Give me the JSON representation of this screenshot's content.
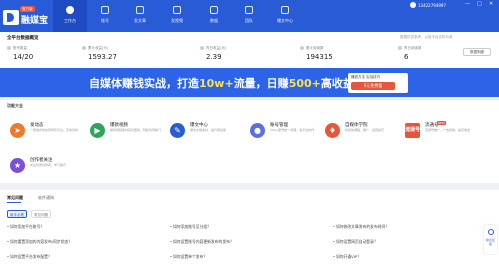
{
  "app": {
    "name": "融媒宝",
    "badge": "官方版"
  },
  "nav": [
    {
      "label": "工作台",
      "active": true
    },
    {
      "label": "账号",
      "active": false
    },
    {
      "label": "发文章",
      "active": false
    },
    {
      "label": "发视频",
      "active": false
    },
    {
      "label": "数据",
      "active": false
    },
    {
      "label": "团队",
      "active": false
    },
    {
      "label": "爆文中心",
      "active": false
    }
  ],
  "user": {
    "phone": "13422794997",
    "minimize": "—",
    "maximize": "□",
    "close": "✕"
  },
  "stats": {
    "title": "全平台数据概览",
    "note": "数据仅供参考，以各平台实际为准",
    "details_button": "数据明细",
    "items": [
      {
        "label": "账号数量",
        "value": "14/20"
      },
      {
        "label": "累计收益(元)",
        "value": "1593.27"
      },
      {
        "label": "昨日收益(元)",
        "value": "2.39"
      },
      {
        "label": "累计阅读数",
        "value": "194315"
      },
      {
        "label": "昨日阅读数",
        "value": "6"
      }
    ]
  },
  "banner": {
    "text_a": "自媒体赚钱实战，打造",
    "text_hl1": "10w+",
    "text_b": "流量，日赚",
    "text_hl2": "500+",
    "text_c": "高收益玩法",
    "promo_top": "赚钱方法 实战技巧",
    "promo_bottom": "0元免费看"
  },
  "features": {
    "title": "功能大全",
    "items": [
      {
        "title": "发动态",
        "desc": "一键发布动态到所有平台，高效省时",
        "icon": "send-icon",
        "color": "#f07a2c",
        "badge": ""
      },
      {
        "title": "爆款视频",
        "desc": "爆款视频素材实时更新，轻松找到热门",
        "icon": "video-icon",
        "color": "#2da55a",
        "badge": ""
      },
      {
        "title": "爆文中心",
        "desc": "爆款文章素材，提升阅读量",
        "icon": "article-icon",
        "color": "#2a5bd7",
        "badge": ""
      },
      {
        "title": "账号管理",
        "desc": "500+账号统一管理，多平台协作",
        "icon": "account-icon",
        "color": "#5b6ee6",
        "badge": ""
      },
      {
        "title": "自媒体学院",
        "desc": "新媒体课程，推广、运营技巧",
        "icon": "academy-icon",
        "color": "#e8553b",
        "badge": ""
      },
      {
        "title": "流通号",
        "desc": "流通号推广，广告投放，提高收益",
        "icon": "promo-icon",
        "color": "#e8553b",
        "badge": "NEW",
        "tag": "流通号"
      },
      {
        "title": "创作者关注",
        "desc": "关注优质创作者，学习技巧",
        "icon": "creator-icon",
        "color": "#7b4fd6",
        "badge": ""
      }
    ]
  },
  "help": {
    "tabs": [
      "常见问题",
      "软件通知"
    ],
    "pills": [
      "新手必看",
      "常见问题"
    ],
    "questions": [
      "如何添加平台账号？",
      "如何添加账号至分组？",
      "如何修改文章发布的发布时间？",
      "如何重置添加的内容发布/同步状态？",
      "如何设置账号内容更新发布的发布？",
      "如何设置网页自动登录？",
      "如何设置平台发布配置？",
      "如何设置单个发布？",
      "如何开通VIP？"
    ]
  },
  "side_help": {
    "label": "建议反馈"
  }
}
